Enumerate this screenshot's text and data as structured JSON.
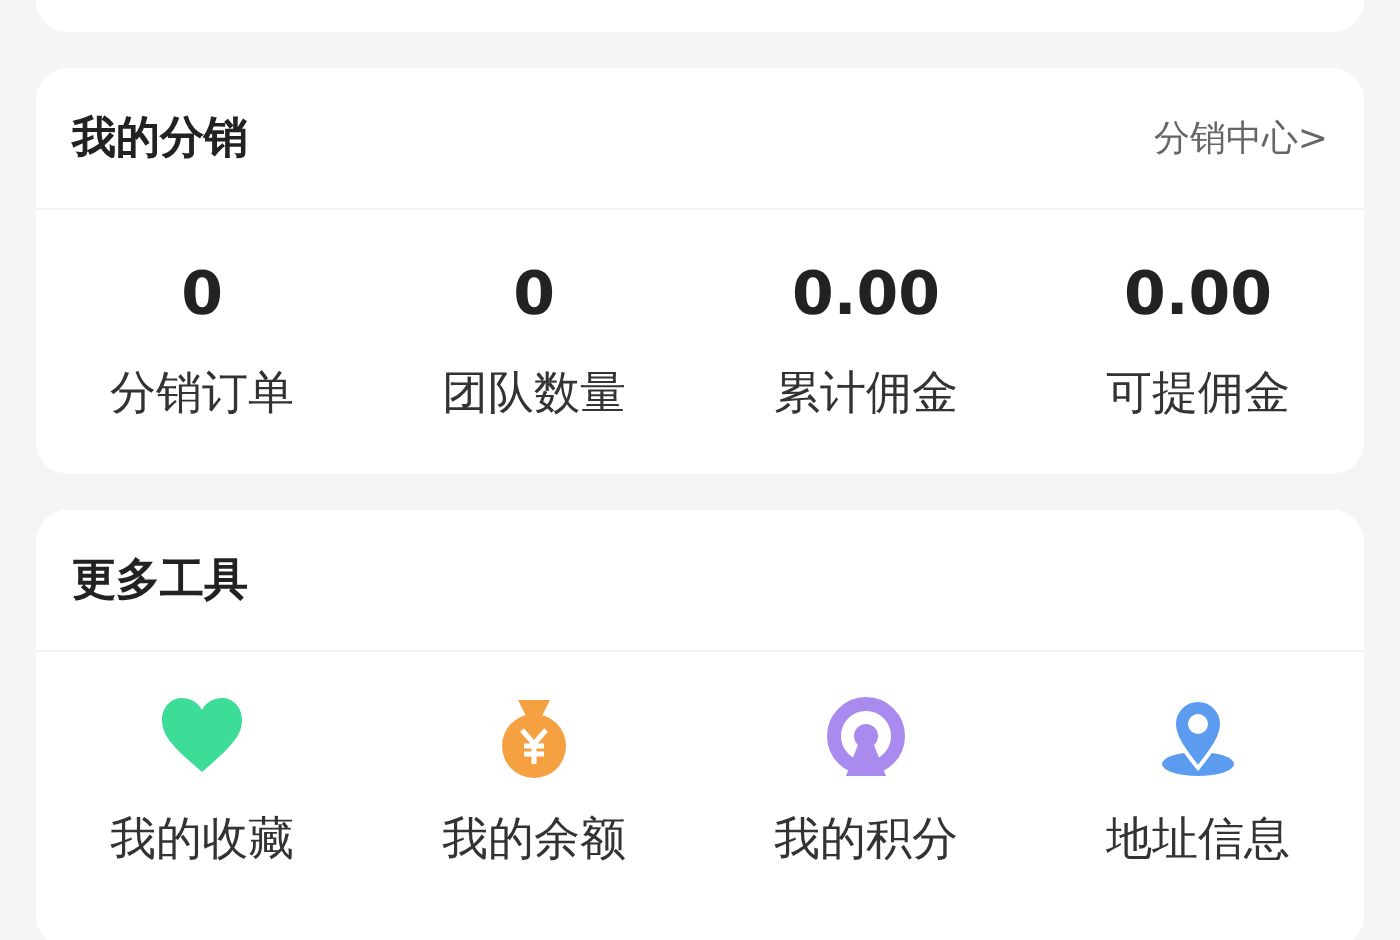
{
  "distribution": {
    "title": "我的分销",
    "link": "分销中心>",
    "stats": [
      {
        "value": "0",
        "label": "分销订单"
      },
      {
        "value": "0",
        "label": "团队数量"
      },
      {
        "value": "0.00",
        "label": "累计佣金"
      },
      {
        "value": "0.00",
        "label": "可提佣金"
      }
    ]
  },
  "tools": {
    "title": "更多工具",
    "items": [
      {
        "kind": "heart",
        "label": "我的收藏"
      },
      {
        "kind": "moneybag",
        "label": "我的余额"
      },
      {
        "kind": "points",
        "label": "我的积分"
      },
      {
        "kind": "location",
        "label": "地址信息"
      }
    ]
  }
}
